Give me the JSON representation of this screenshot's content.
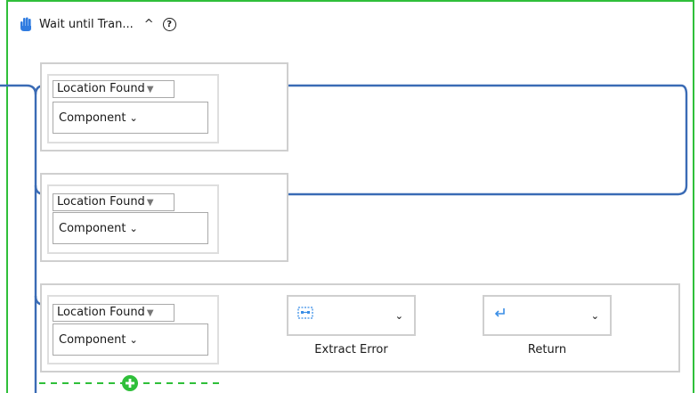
{
  "header": {
    "title": "Wait until Tran...",
    "collapse_glyph": "^",
    "help_glyph": "?",
    "hand_icon": "hand-icon"
  },
  "branches": [
    {
      "condition": "Location Found",
      "component": "Component"
    },
    {
      "condition": "Location Found",
      "component": "Component"
    },
    {
      "condition": "Location Found",
      "component": "Component"
    }
  ],
  "actions": [
    {
      "label": "Extract Error",
      "icon": "extract-icon"
    },
    {
      "label": "Return",
      "icon": "return-icon"
    }
  ],
  "glyphs": {
    "dropdown_triangle": "▼",
    "chevron": "⌄"
  },
  "colors": {
    "wire": "#3a6bb5",
    "frame": "#2fbf3a",
    "add": "#2fbf3a"
  }
}
